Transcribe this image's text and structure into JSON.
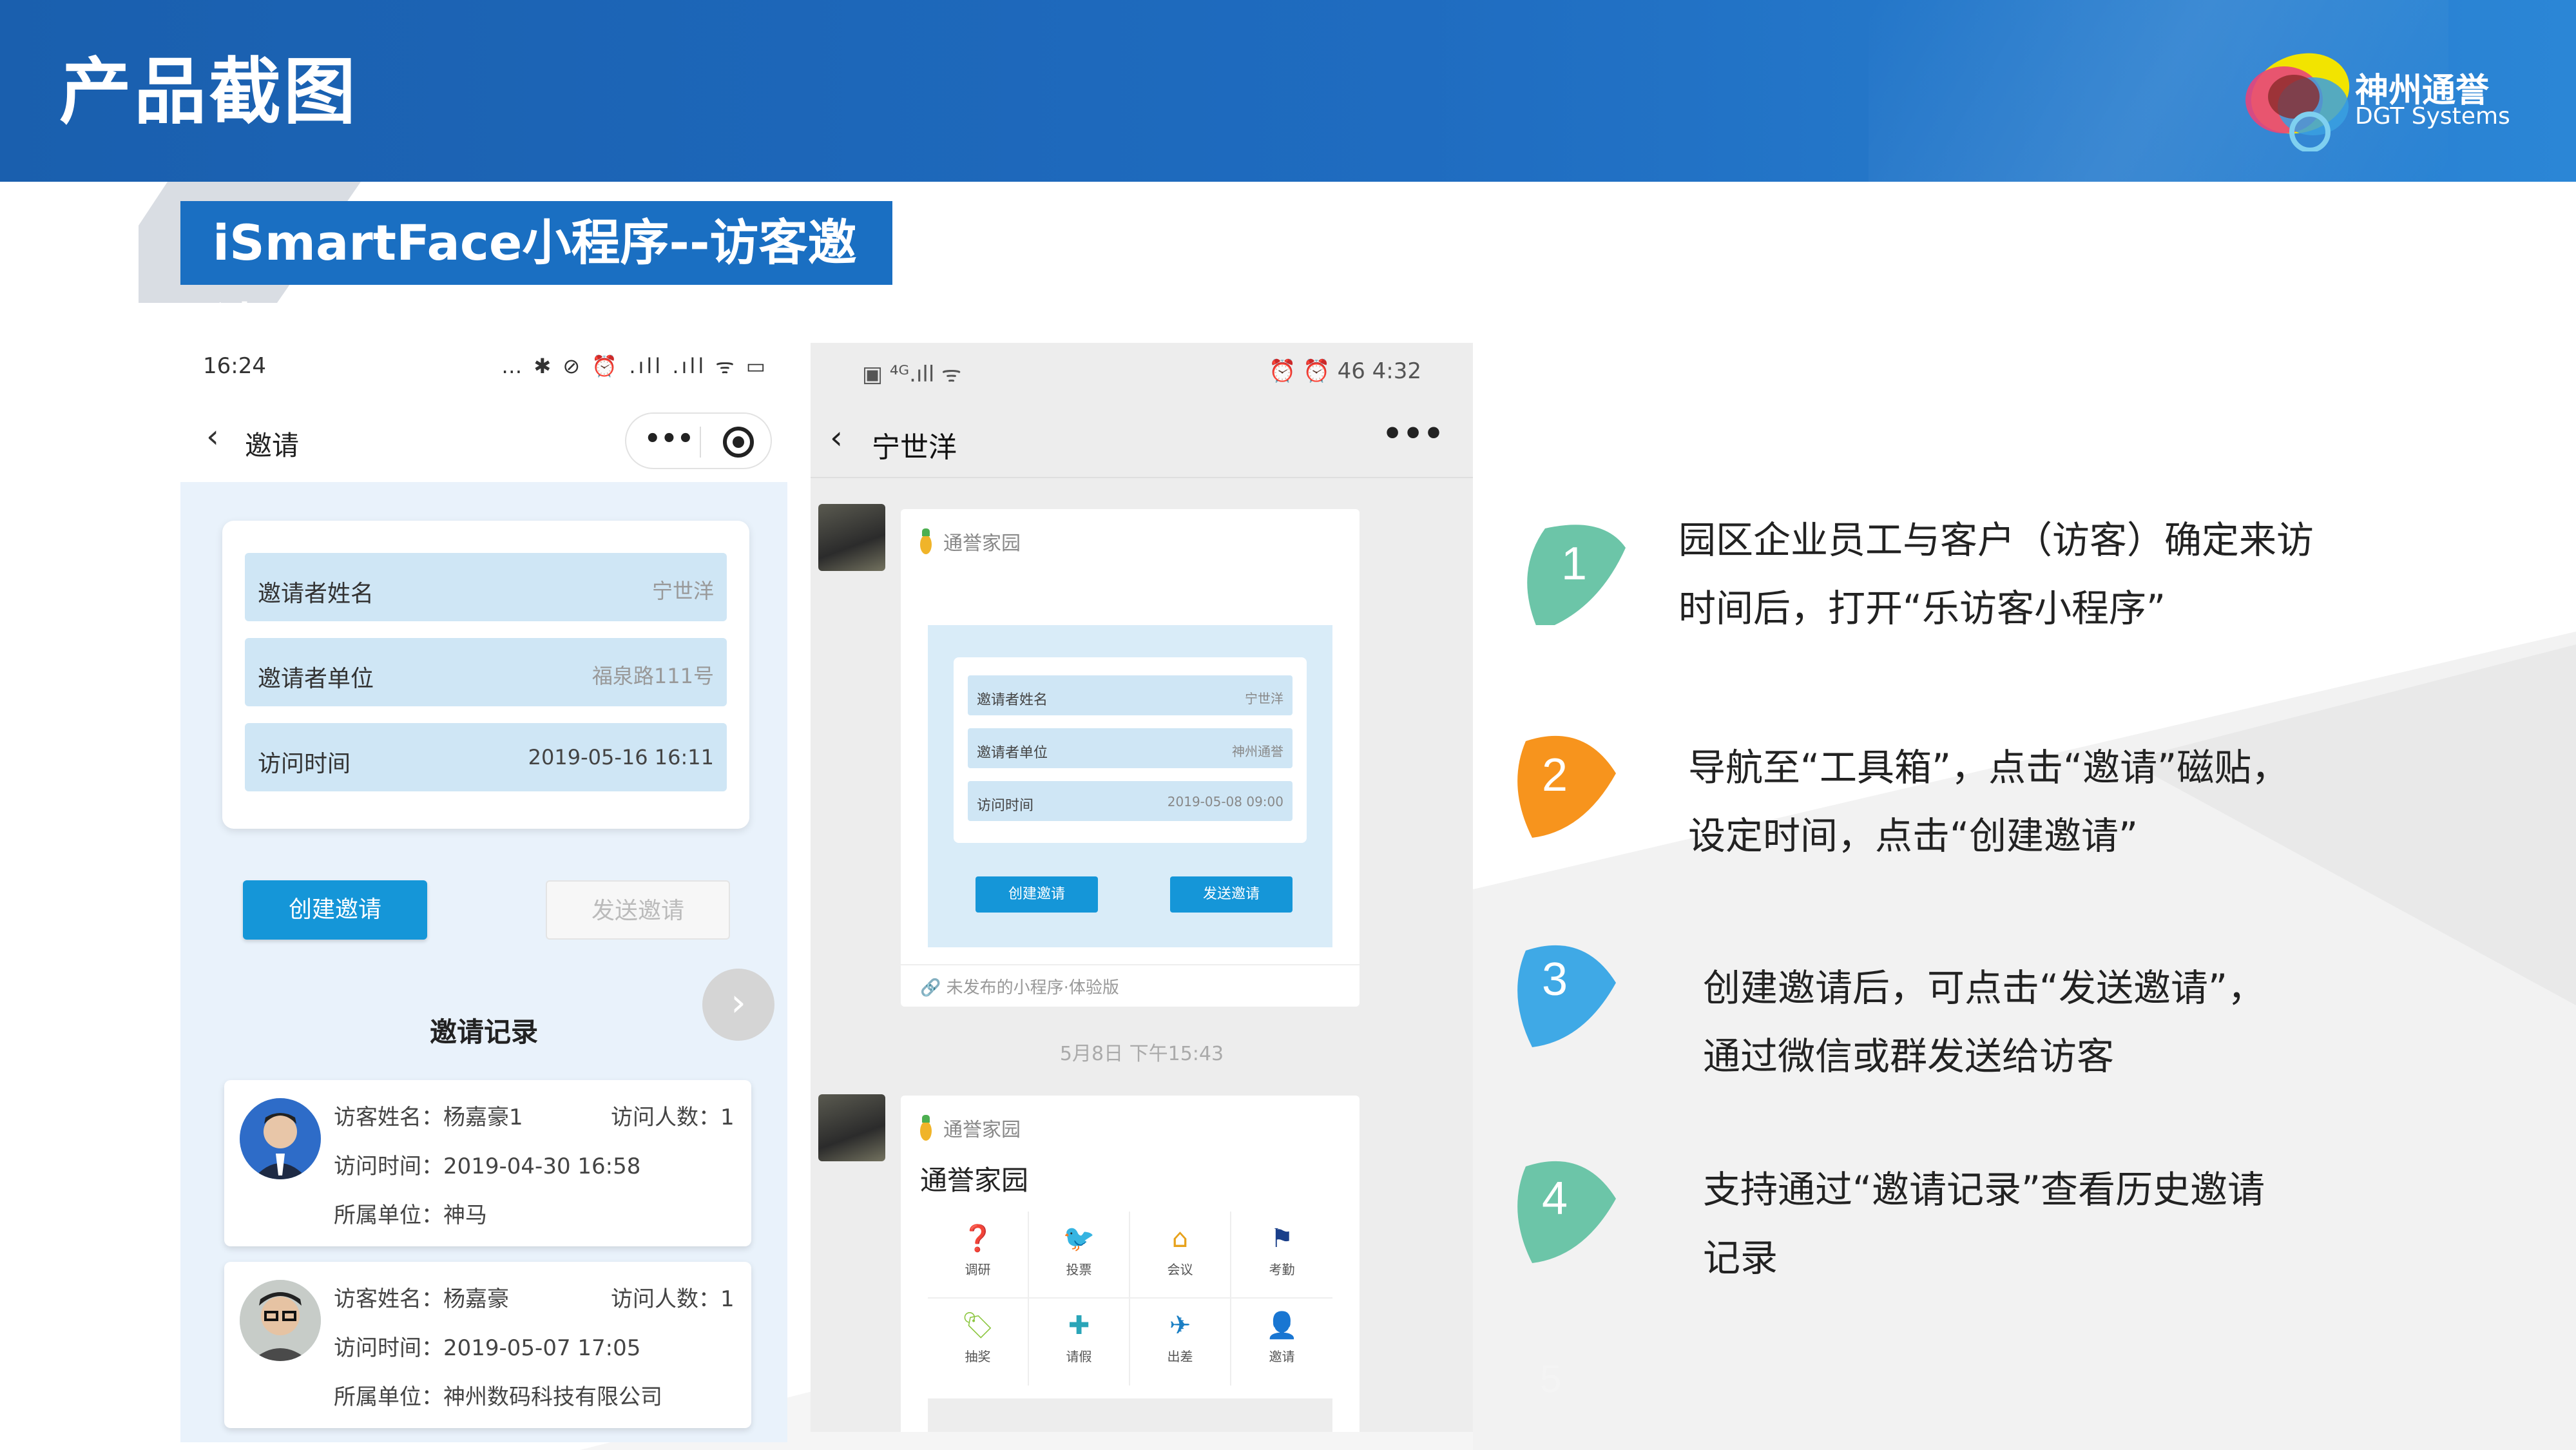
{
  "slide": {
    "title": "产品截图",
    "subtitle": "iSmartFace小程序--访客邀请",
    "logo": {
      "name_cn": "神州通誉",
      "name_en": "DGT Systems"
    },
    "page_number": "5"
  },
  "phone1": {
    "status_time": "16:24",
    "status_icons": "… ✱ ⊘ ⏰ .ıll .ıll ᯤ ▭",
    "nav_title": "邀请",
    "capsule_dots": "•••",
    "form": [
      {
        "label": "邀请者姓名",
        "value": "宁世洋"
      },
      {
        "label": "邀请者单位",
        "value": "福泉路111号"
      },
      {
        "label": "访问时间",
        "value": "2019-05-16   16:11"
      }
    ],
    "create_button": "创建邀请",
    "send_button": "发送邀请",
    "records_title": "邀请记录",
    "records": [
      {
        "name": "访客姓名：杨嘉豪1",
        "count": "访问人数：1",
        "time": "访问时间：2019-04-30 16:58",
        "unit": "所属单位：神马"
      },
      {
        "name": "访客姓名：杨嘉豪",
        "count": "访问人数：1",
        "time": "访问时间：2019-05-07 17:05",
        "unit": "所属单位：神州数码科技有限公司"
      }
    ]
  },
  "phone2": {
    "status_left": "▣ ⁴ᴳ.ıll ᯤ",
    "status_right": "⏰ ⏰ 46 4:32",
    "chat_title": "宁世洋",
    "more": "•••",
    "app_name": "通誉家园",
    "mini_form": [
      {
        "label": "邀请者姓名",
        "value": "宁世洋"
      },
      {
        "label": "邀请者单位",
        "value": "神州通誉"
      },
      {
        "label": "访问时间",
        "value": "2019-05-08   09:00"
      }
    ],
    "mini_create": "创建邀请",
    "mini_send": "发送邀请",
    "footer_note": "未发布的小程序·体验版",
    "chat_time": "5月8日 下午15:43",
    "app_name2": "通誉家园",
    "card_title": "通誉家园",
    "grid": [
      {
        "label": "调研",
        "icon": "question-icon"
      },
      {
        "label": "投票",
        "icon": "bird-icon"
      },
      {
        "label": "会议",
        "icon": "home-icon"
      },
      {
        "label": "考勤",
        "icon": "flag-icon"
      },
      {
        "label": "抽奖",
        "icon": "tag-icon"
      },
      {
        "label": "请假",
        "icon": "medkit-icon"
      },
      {
        "label": "出差",
        "icon": "plane-icon"
      },
      {
        "label": "邀请",
        "icon": "person-icon"
      }
    ]
  },
  "steps": [
    {
      "number": "1",
      "line1": "园区企业员工与客户（访客）确定来访",
      "line2": "时间后，打开“乐访客小程序”",
      "color": "#6cc5a8"
    },
    {
      "number": "2",
      "line1": "导航至“工具箱”，点击“邀请”磁贴，",
      "line2": "设定时间，点击“创建邀请”",
      "color": "#f7941d"
    },
    {
      "number": "3",
      "line1": "创建邀请后，可点击“发送邀请”，",
      "line2": "通过微信或群发送给访客",
      "color": "#3fa9e6"
    },
    {
      "number": "4",
      "line1": "支持通过“邀请记录”查看历史邀请",
      "line2": "记录",
      "color": "#6cc5a8"
    }
  ],
  "colors": {
    "header_blue": "#1a5fae",
    "accent_blue": "#1596d8",
    "subtitle_bg": "#1a6fc2"
  }
}
